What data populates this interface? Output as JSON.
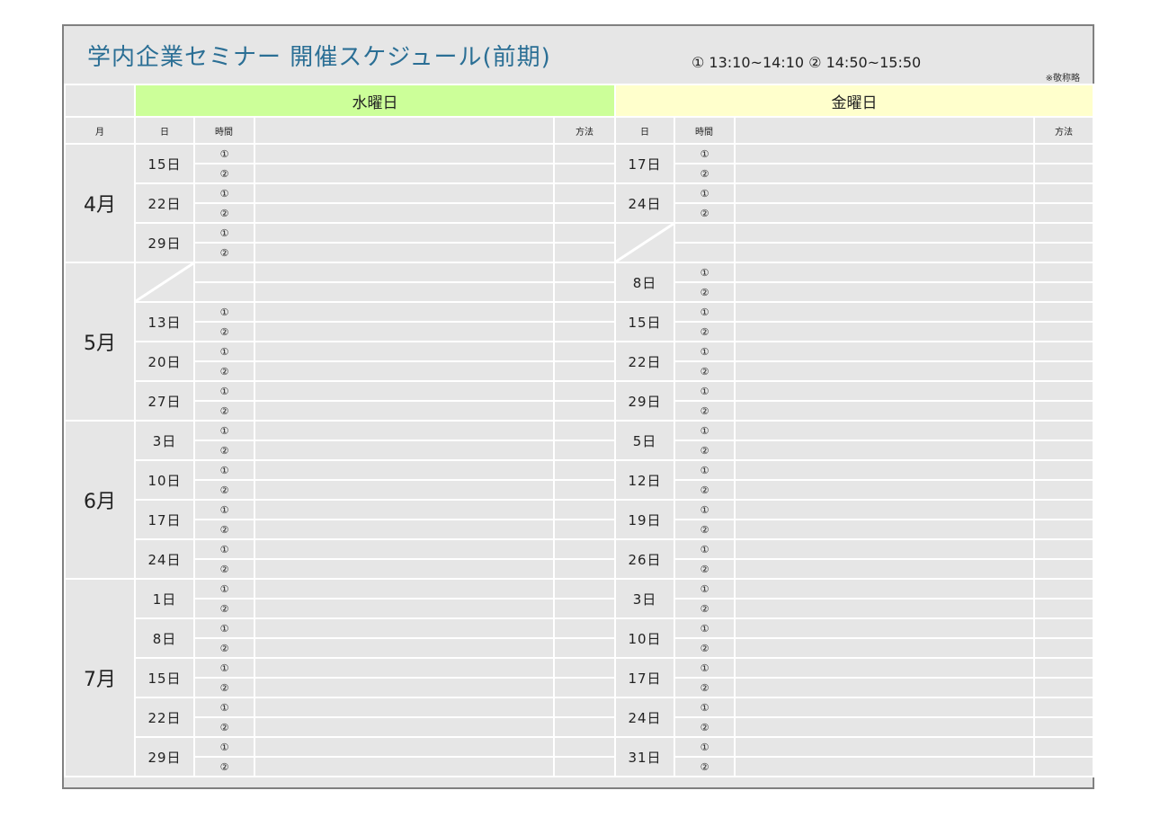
{
  "title": "学内企業セミナー 開催スケジュール(前期)",
  "times": "① 13:10~14:10 ② 14:50~15:50",
  "honorific_note": "※敬称略",
  "headers": {
    "wednesday": "水曜日",
    "friday": "金曜日",
    "month": "月",
    "day": "日",
    "time": "時間",
    "method": "方法"
  },
  "slots": [
    "①",
    "②"
  ],
  "months": [
    {
      "label": "4月",
      "weeks": [
        {
          "wed": "15日",
          "fri": "17日"
        },
        {
          "wed": "22日",
          "fri": "24日"
        },
        {
          "wed": "29日",
          "fri": ""
        }
      ]
    },
    {
      "label": "5月",
      "weeks": [
        {
          "wed": "",
          "fri": "8日"
        },
        {
          "wed": "13日",
          "fri": "15日"
        },
        {
          "wed": "20日",
          "fri": "22日"
        },
        {
          "wed": "27日",
          "fri": "29日"
        }
      ]
    },
    {
      "label": "6月",
      "weeks": [
        {
          "wed": "3日",
          "fri": "5日"
        },
        {
          "wed": "10日",
          "fri": "12日"
        },
        {
          "wed": "17日",
          "fri": "19日"
        },
        {
          "wed": "24日",
          "fri": "26日"
        }
      ]
    },
    {
      "label": "7月",
      "weeks": [
        {
          "wed": "1日",
          "fri": "3日"
        },
        {
          "wed": "8日",
          "fri": "10日"
        },
        {
          "wed": "15日",
          "fri": "17日"
        },
        {
          "wed": "22日",
          "fri": "24日"
        },
        {
          "wed": "29日",
          "fri": "31日"
        }
      ]
    }
  ],
  "colors": {
    "title": "#2b6f95",
    "wednesday_bg": "#ccff99",
    "friday_bg": "#ffffcc",
    "cell_bg": "#e6e6e6",
    "border": "#808080"
  }
}
